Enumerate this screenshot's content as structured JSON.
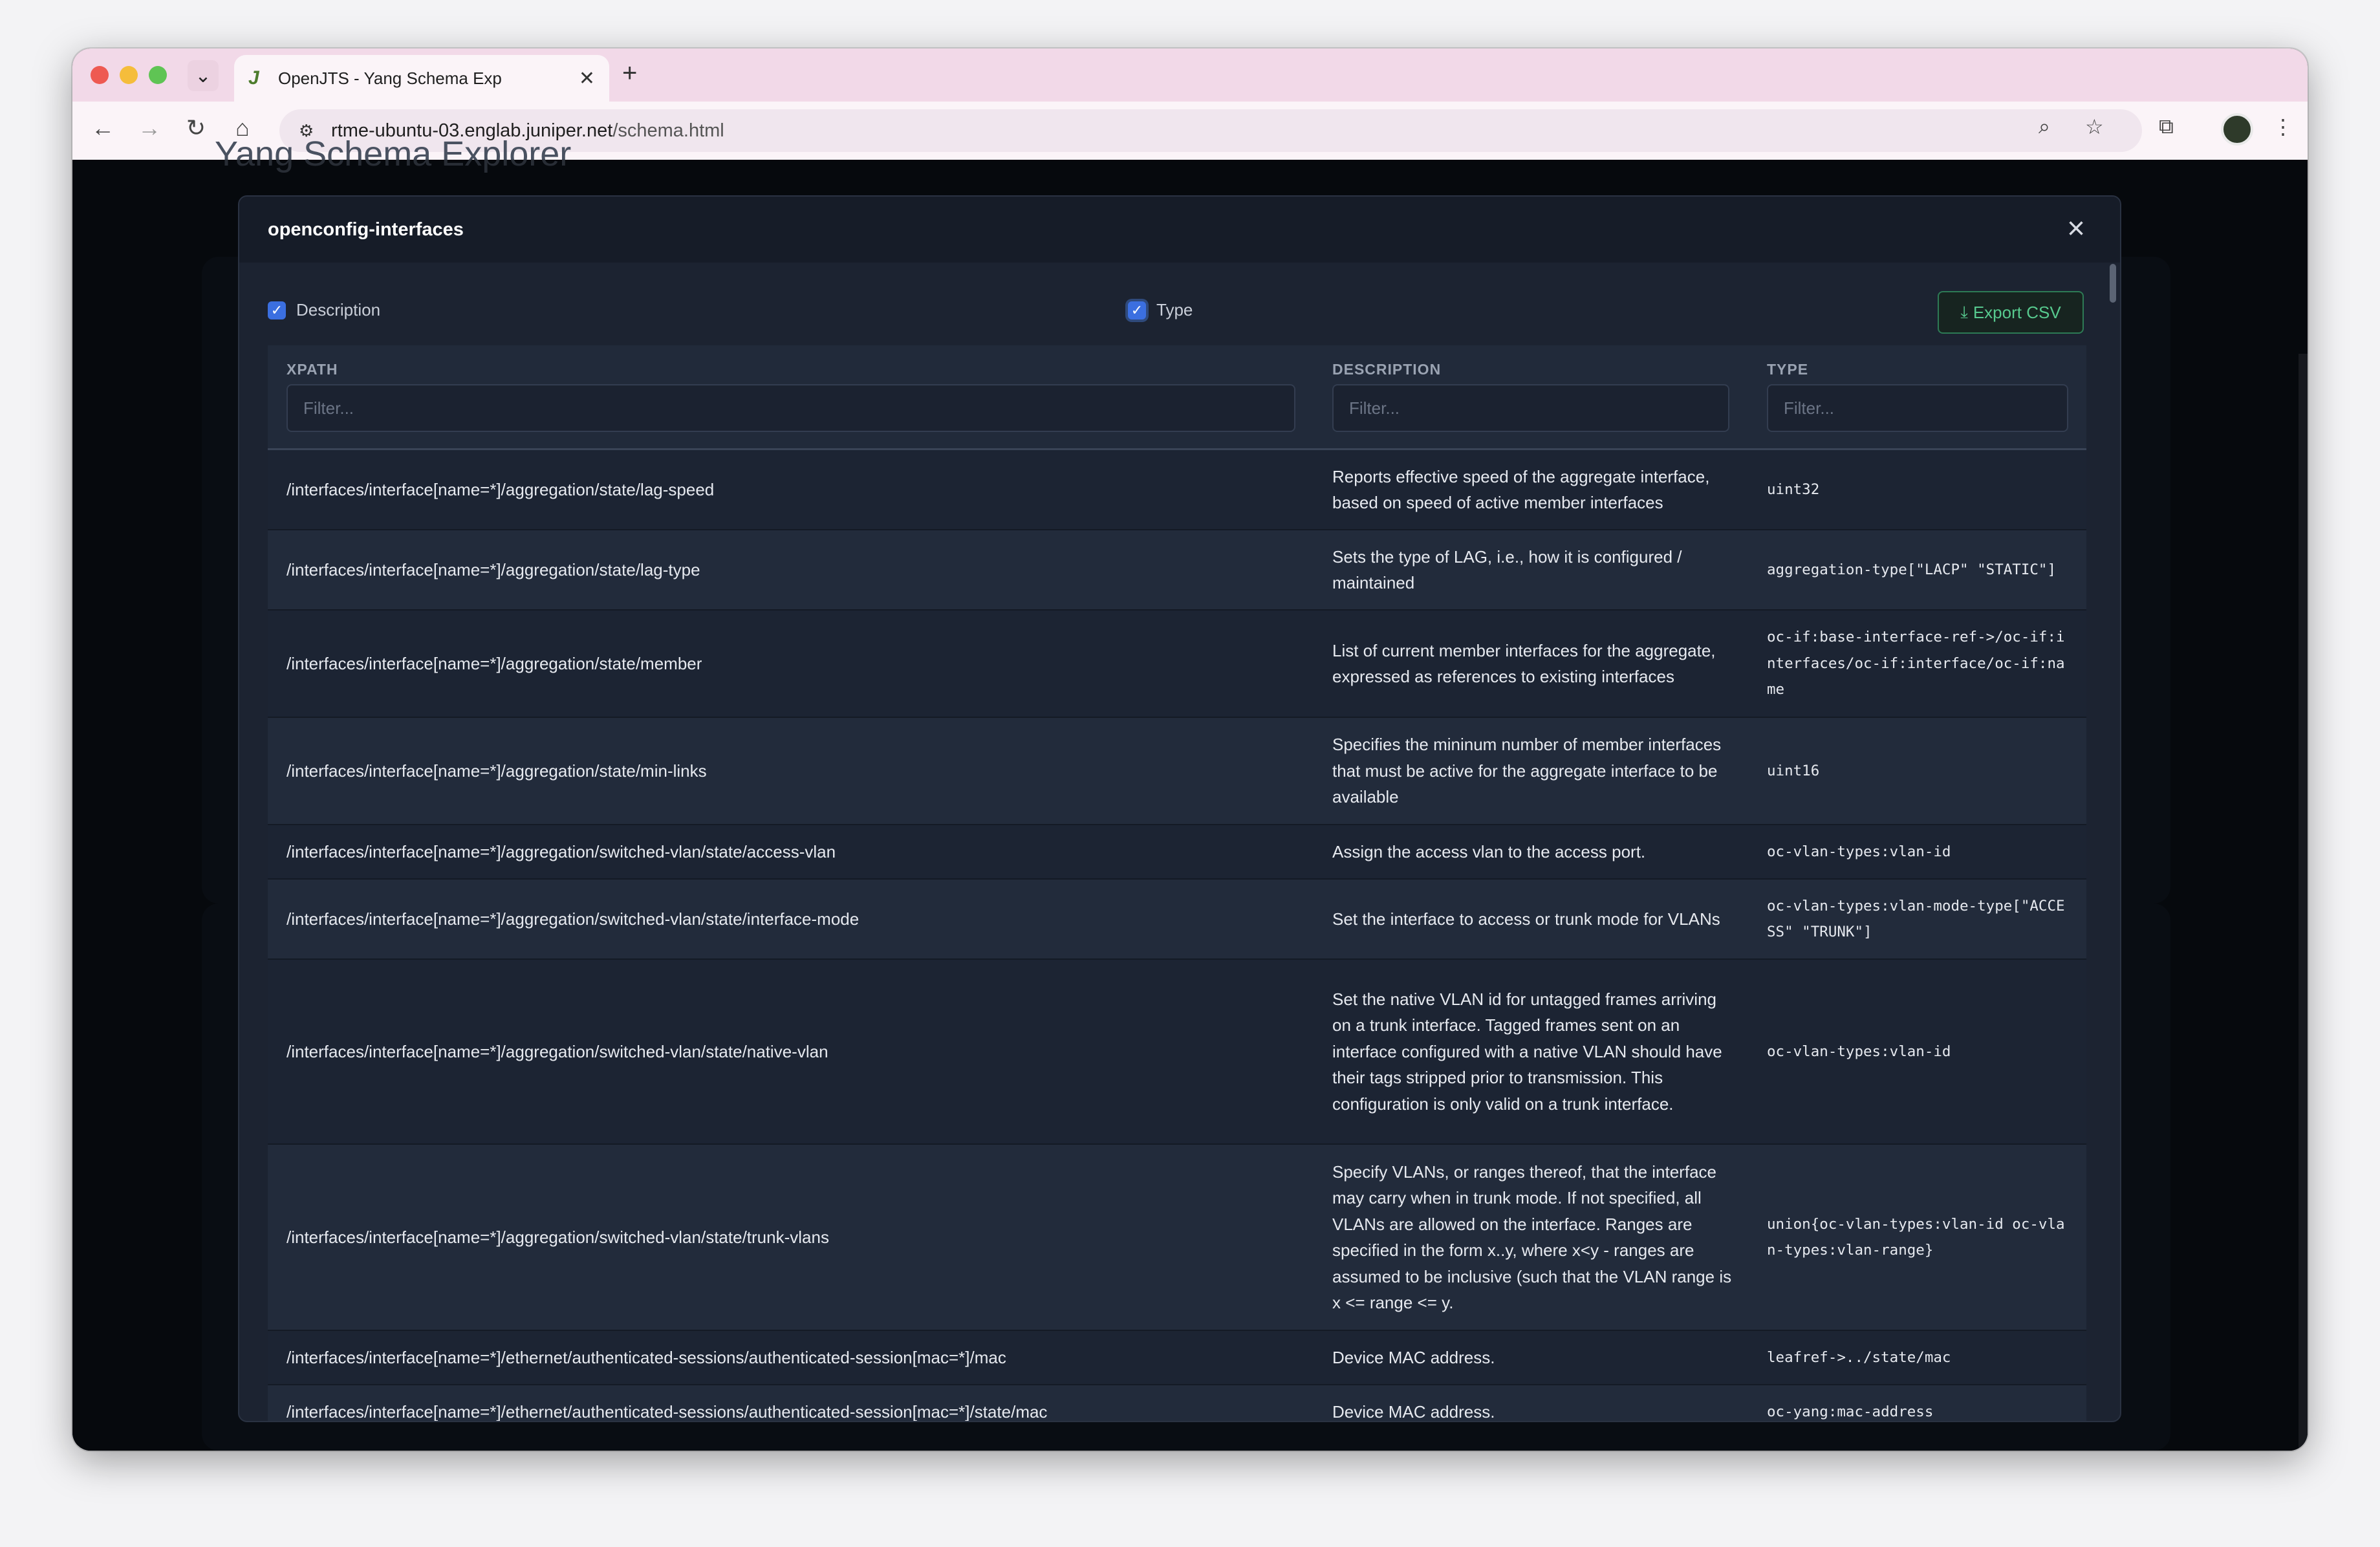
{
  "browser": {
    "tab_title": "OpenJTS - Yang Schema Exp",
    "url_host": "rtme-ubuntu-03.englab.juniper.net",
    "url_path": "/schema.html"
  },
  "page": {
    "title": "Yang Schema Explorer"
  },
  "modal": {
    "title": "openconfig-interfaces",
    "checkbox_description": "Description",
    "checkbox_type": "Type",
    "export_label": "Export CSV",
    "columns": {
      "xpath": "XPATH",
      "description": "DESCRIPTION",
      "type": "TYPE"
    },
    "filter_placeholder": "Filter...",
    "rows": [
      {
        "xpath": "/interfaces/interface[name=*]/aggregation/state/lag-speed",
        "description": "Reports effective speed of the aggregate interface, based on speed of active member interfaces",
        "type": "uint32"
      },
      {
        "xpath": "/interfaces/interface[name=*]/aggregation/state/lag-type",
        "description": "Sets the type of LAG, i.e., how it is configured / maintained",
        "type": "aggregation-type[\"LACP\" \"STATIC\"]"
      },
      {
        "xpath": "/interfaces/interface[name=*]/aggregation/state/member",
        "description": "List of current member interfaces for the aggregate, expressed as references to existing interfaces",
        "type": "oc-if:base-interface-ref->/oc-if:interfaces/oc-if:interface/oc-if:name"
      },
      {
        "xpath": "/interfaces/interface[name=*]/aggregation/state/min-links",
        "description": "Specifies the mininum number of member interfaces that must be active for the aggregate interface to be available",
        "type": "uint16"
      },
      {
        "xpath": "/interfaces/interface[name=*]/aggregation/switched-vlan/state/access-vlan",
        "description": "Assign the access vlan to the access port.",
        "type": "oc-vlan-types:vlan-id"
      },
      {
        "xpath": "/interfaces/interface[name=*]/aggregation/switched-vlan/state/interface-mode",
        "description": "Set the interface to access or trunk mode for VLANs",
        "type": "oc-vlan-types:vlan-mode-type[\"ACCESS\" \"TRUNK\"]"
      },
      {
        "xpath": "/interfaces/interface[name=*]/aggregation/switched-vlan/state/native-vlan",
        "description": "Set the native VLAN id for untagged frames arriving on a trunk interface. Tagged frames sent on an interface configured with a native VLAN should have their tags stripped prior to transmission. This configuration is only valid on a trunk interface.",
        "type": "oc-vlan-types:vlan-id"
      },
      {
        "xpath": "/interfaces/interface[name=*]/aggregation/switched-vlan/state/trunk-vlans",
        "description": "Specify VLANs, or ranges thereof, that the interface may carry when in trunk mode. If not specified, all VLANs are allowed on the interface. Ranges are specified in the form x..y, where x<y - ranges are assumed to be inclusive (such that the VLAN range is x <= range <= y.",
        "type": "union{oc-vlan-types:vlan-id oc-vlan-types:vlan-range}"
      },
      {
        "xpath": "/interfaces/interface[name=*]/ethernet/authenticated-sessions/authenticated-session[mac=*]/mac",
        "description": "Device MAC address.",
        "type": "leafref->../state/mac"
      },
      {
        "xpath": "/interfaces/interface[name=*]/ethernet/authenticated-sessions/authenticated-session[mac=*]/state/mac",
        "description": "Device MAC address.",
        "type": "oc-yang:mac-address"
      }
    ]
  }
}
